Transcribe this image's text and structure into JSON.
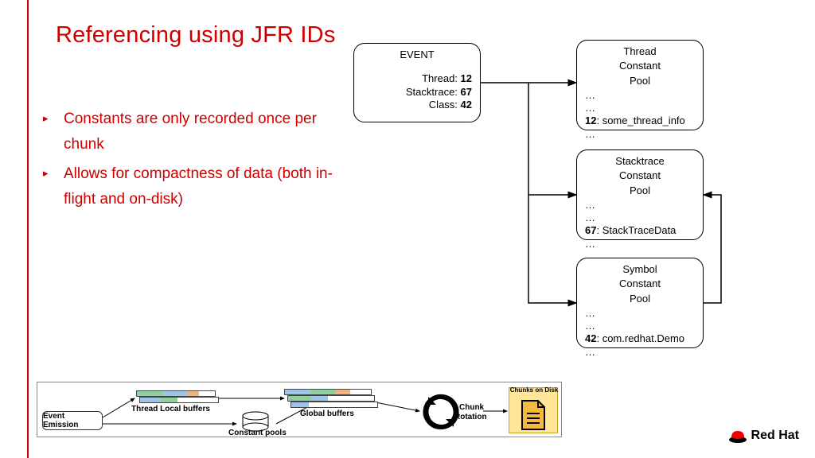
{
  "title": "Referencing using JFR IDs",
  "bullets": [
    "Constants are only recorded once per chunk",
    "Allows for compactness of data (both in-flight and on-disk)"
  ],
  "event": {
    "heading": "EVENT",
    "rows": {
      "thread_label": "Thread: ",
      "thread_val": "12",
      "stack_label": "Stacktrace: ",
      "stack_val": "67",
      "class_label": "Class: ",
      "class_val": "42"
    }
  },
  "pools": {
    "thread": {
      "title1": "Thread",
      "title2": "Constant",
      "title3": "Pool",
      "key": "12",
      "val": ": some_thread_info"
    },
    "stack": {
      "title1": "Stacktrace",
      "title2": "Constant",
      "title3": "Pool",
      "key": "67",
      "val": ": StackTraceData"
    },
    "symbol": {
      "title1": "Symbol",
      "title2": "Constant",
      "title3": "Pool",
      "key": "42",
      "val": ": com.redhat.Demo"
    }
  },
  "bottom": {
    "event_emission": "Event Emission",
    "thread_local": "Thread Local buffers",
    "constant_pools": "Constant pools",
    "global_buffers": "Global buffers",
    "chunk_rotation1": "Chunk",
    "chunk_rotation2": "Rotation",
    "chunks_on_disk": "Chunks on Disk"
  },
  "brand": "Red Hat",
  "chart_data": {
    "type": "diagram",
    "title": "Referencing using JFR IDs",
    "event": {
      "Thread": 12,
      "Stacktrace": 67,
      "Class": 42
    },
    "constant_pools": [
      {
        "name": "Thread Constant Pool",
        "entries": {
          "12": "some_thread_info"
        }
      },
      {
        "name": "Stacktrace Constant Pool",
        "entries": {
          "67": "StackTraceData"
        }
      },
      {
        "name": "Symbol Constant Pool",
        "entries": {
          "42": "com.redhat.Demo"
        }
      }
    ],
    "flow": [
      "Event Emission",
      "Thread Local buffers",
      "Constant pools",
      "Global buffers",
      "Chunk Rotation",
      "Chunks on Disk"
    ]
  }
}
